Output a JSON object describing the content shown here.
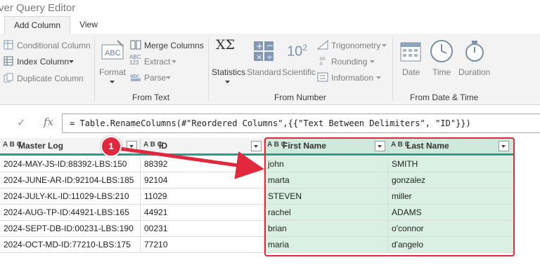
{
  "window": {
    "title": "ver Query Editor"
  },
  "tabs": [
    {
      "label": "Add Column",
      "active": true
    },
    {
      "label": "View",
      "active": false
    }
  ],
  "ribbon": {
    "general": {
      "conditional_column": "Conditional Column",
      "index_column": "Index Column",
      "duplicate_column": "Duplicate Column"
    },
    "from_text": {
      "format": "Format",
      "merge_columns": "Merge Columns",
      "extract": "Extract",
      "parse": "Parse",
      "group_label": "From Text",
      "abc_123": "ABC\n123"
    },
    "from_number": {
      "statistics": "Statistics",
      "standard": "Standard",
      "scientific": "Scientific",
      "trigonometry": "Trigonometry",
      "rounding": "Rounding",
      "information": "Information",
      "group_label": "From Number",
      "sigma_symbols": "XΣ",
      "ten_squared": "10",
      "exp": "2"
    },
    "from_date_time": {
      "date": "Date",
      "time": "Time",
      "duration": "Duration",
      "group_label": "From Date & Time"
    }
  },
  "formula_bar": {
    "check": "✓",
    "fx": "fx",
    "formula": "= Table.RenameColumns(#\"Reordered Columns\",{{\"Text Between Delimiters\", \"ID\"}})"
  },
  "table": {
    "type_prefix": "A B C",
    "columns": [
      "Master Log",
      "ID",
      "First Name",
      "Last Name"
    ],
    "rows": [
      [
        "2024-MAY-JS-ID:88392-LBS:150",
        "88392",
        "john",
        "SMITH"
      ],
      [
        "2024-JUNE-AR-ID:92104-LBS:185",
        "92104",
        "marta",
        "gonzalez"
      ],
      [
        "2024-JULY-KL-ID:11029-LBS:210",
        "11029",
        "STEVEN",
        "miller"
      ],
      [
        "2024-AUG-TP-ID:44921-LBS:165",
        "44921",
        "rachel",
        "ADAMS"
      ],
      [
        "2024-SEPT-DB-ID:00231-LBS:190",
        "00231",
        "brian",
        "o'connor"
      ],
      [
        "2024-OCT-MD-ID:77210-LBS:175",
        "77210",
        "maria",
        "d'angelo"
      ]
    ]
  },
  "annotation": {
    "number": "1",
    "color": "#e1283c"
  },
  "colors": {
    "accent_teal": "#21a08e",
    "highlight_green": "#d9f0e3",
    "callout_red": "#e1283c"
  }
}
